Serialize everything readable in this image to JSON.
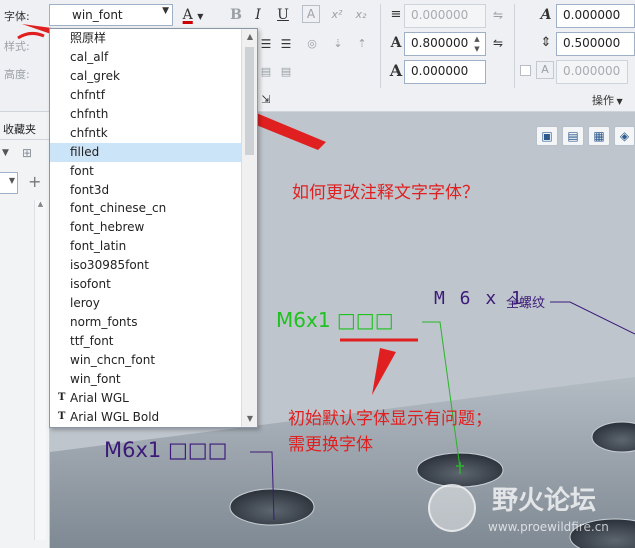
{
  "ribbon": {
    "font_label": "字体:",
    "style_label": "样式:",
    "height_label": "高度:",
    "font_value": "win_font",
    "color_icon": "A",
    "bold": "B",
    "italic": "I",
    "underline": "U",
    "frame_text": "A",
    "superscript": "x²",
    "subscript": "x₂",
    "fields": {
      "line_spacing": "0.000000",
      "height": "0.800000",
      "width": "0.000000",
      "char_spacing": "0.000000",
      "line_gap": "0.500000",
      "angle": "0.000000"
    },
    "ops_label": "操作"
  },
  "favorites_label": "收藏夹",
  "dropdown": {
    "items": [
      "照原样",
      "cal_alf",
      "cal_grek",
      "chfntf",
      "chfnth",
      "chfntk",
      "filled",
      "font",
      "font3d",
      "font_chinese_cn",
      "font_hebrew",
      "font_latin",
      "iso30985font",
      "isofont",
      "leroy",
      "norm_fonts",
      "ttf_font",
      "win_chcn_font",
      "win_font",
      "Arial WGL",
      "Arial WGL Bold"
    ],
    "selected_index": 6,
    "truetype_indices": [
      19,
      20
    ]
  },
  "annotations": {
    "question": "如何更改注释文字字体？",
    "problem_line1": "初始默认字体显示有问题；",
    "problem_line2": "需更换字体",
    "m6_green": "M6x1 □□□",
    "m6_purple_right": "M 6 x 1",
    "thread_label": "全螺纹",
    "m6_purple_left": "M6x1 □□□"
  },
  "watermark": {
    "name": "野火论坛",
    "url": "www.proewildfire.cn"
  },
  "colors": {
    "accent_red": "#e02020",
    "green": "#1fc21f",
    "purple": "#3c1a78",
    "selection": "#cce4f7"
  }
}
